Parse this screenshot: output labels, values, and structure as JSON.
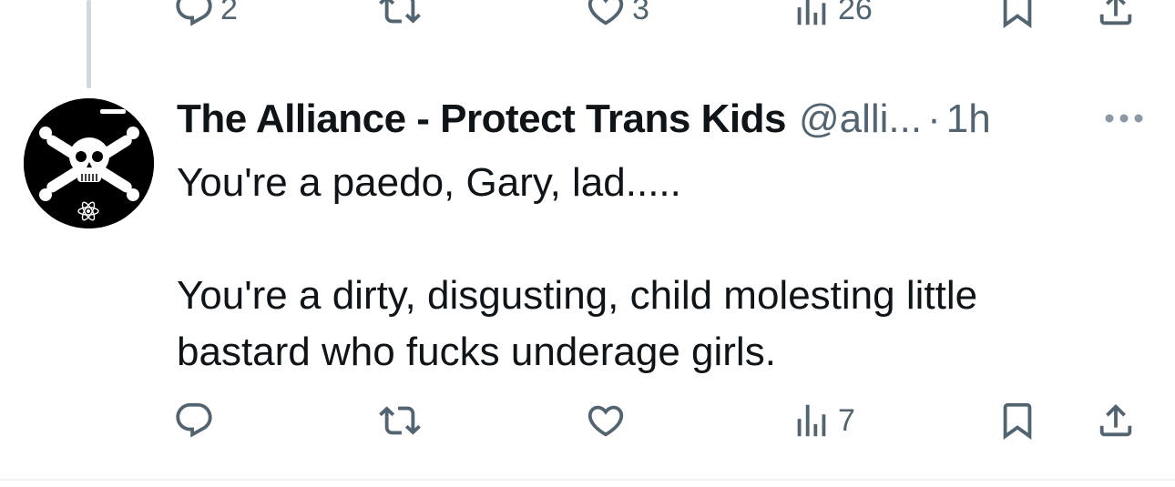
{
  "previous_post": {
    "actions": {
      "reply_count": "2",
      "repost_count": "",
      "like_count": "3",
      "views_count": "26"
    }
  },
  "post": {
    "author_name": "The Alliance - Protect Trans Kids",
    "handle": "@alli...",
    "separator": "·",
    "time": "1h",
    "text_paragraph_1": "You're a paedo, Gary, lad.....",
    "text_paragraph_2_line_1": "You're a dirty, disgusting, child molesting little",
    "text_paragraph_2_line_2": "bastard who fucks underage girls.",
    "actions": {
      "reply_count": "",
      "repost_count": "",
      "like_count": "",
      "views_count": "7"
    }
  },
  "icons": {
    "reply": "reply-icon",
    "repost": "repost-icon",
    "like": "heart-icon",
    "views": "views-icon",
    "bookmark": "bookmark-icon",
    "share": "share-icon",
    "more": "more-icon"
  },
  "colors": {
    "text_primary": "#0f1419",
    "text_secondary": "#536471",
    "thread_line": "#cfd9de",
    "divider": "#eff3f4"
  }
}
